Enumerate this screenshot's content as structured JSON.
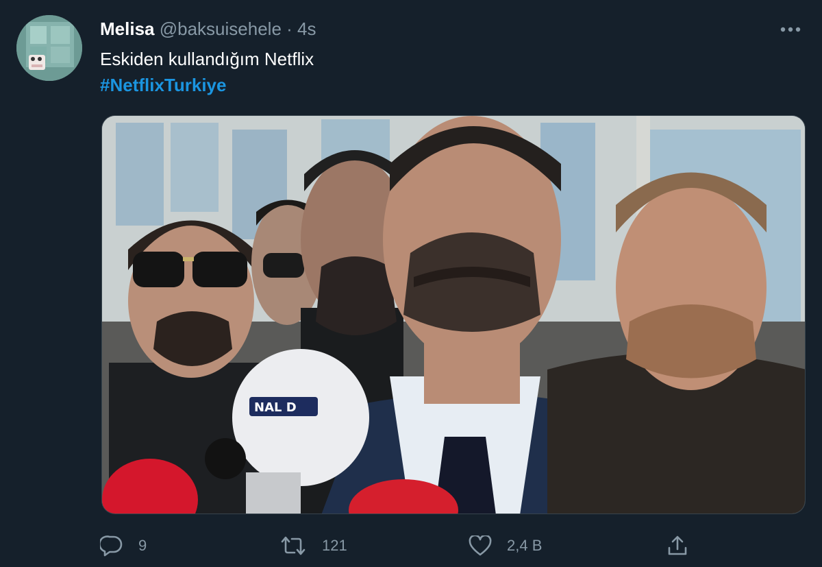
{
  "tweet": {
    "display_name": "Melisa",
    "handle": "@baksuisehele",
    "separator": "·",
    "time": "4s",
    "text": "Eskiden kullandığım Netflix",
    "hashtag": "#NetflixTurkiye",
    "media_logo_text": "NAL D"
  },
  "actions": {
    "reply_count": "9",
    "retweet_count": "121",
    "like_count": "2,4 B"
  },
  "icons": {
    "avatar": "avatar",
    "more": "more-icon",
    "reply": "reply-icon",
    "retweet": "retweet-icon",
    "like": "heart-icon",
    "share": "share-icon"
  },
  "colors": {
    "background": "#15202b",
    "text": "#ffffff",
    "secondary": "#8899a6",
    "hashtag": "#1b95e0"
  }
}
